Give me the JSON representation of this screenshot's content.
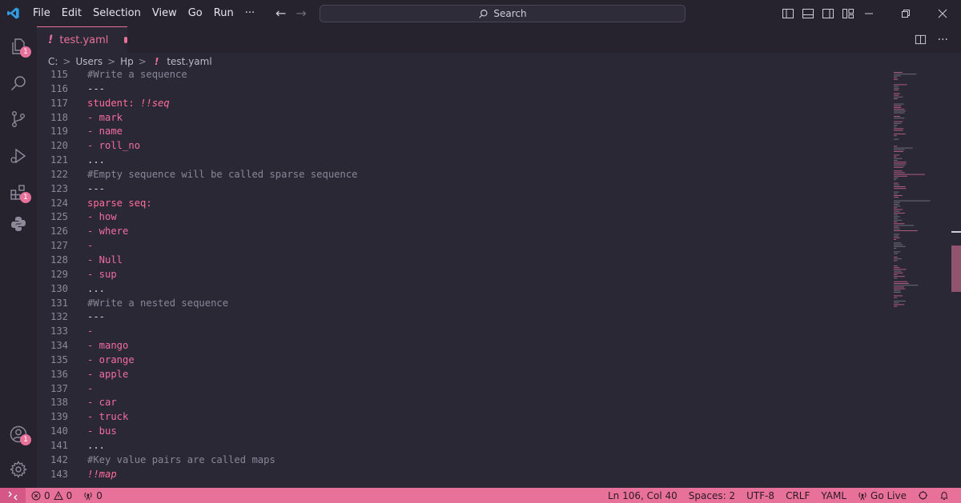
{
  "menu": [
    "File",
    "Edit",
    "Selection",
    "View",
    "Go",
    "Run",
    "···"
  ],
  "search": {
    "label": "Search"
  },
  "activity_badges": {
    "explorer": "1",
    "extensions": "1",
    "accounts": "1"
  },
  "tab": {
    "prefix": "!",
    "label": "test.yaml"
  },
  "breadcrumb": {
    "drive": "C:",
    "users": "Users",
    "user": "Hp",
    "file_prefix": "!",
    "file": "test.yaml"
  },
  "code_lines": [
    {
      "num": "115",
      "text": "#Write a sequence",
      "cls": "c-comment"
    },
    {
      "num": "116",
      "text": "---",
      "cls": "c-punct"
    },
    {
      "num": "117",
      "text": "student: ",
      "cls": "c-key",
      "tag": "!!seq"
    },
    {
      "num": "118",
      "text": "- mark",
      "cls": "c-item"
    },
    {
      "num": "119",
      "text": "- name",
      "cls": "c-item"
    },
    {
      "num": "120",
      "text": "- roll_no",
      "cls": "c-item"
    },
    {
      "num": "121",
      "text": "...",
      "cls": "c-punct"
    },
    {
      "num": "122",
      "text": "#Empty sequence will be called sparse sequence",
      "cls": "c-comment"
    },
    {
      "num": "123",
      "text": "---",
      "cls": "c-punct"
    },
    {
      "num": "124",
      "text": "sparse seq:",
      "cls": "c-key"
    },
    {
      "num": "125",
      "text": "- how",
      "cls": "c-item"
    },
    {
      "num": "126",
      "text": "- where",
      "cls": "c-item"
    },
    {
      "num": "127",
      "text": "-",
      "cls": "c-item"
    },
    {
      "num": "128",
      "text": "- Null",
      "cls": "c-item"
    },
    {
      "num": "129",
      "text": "- sup",
      "cls": "c-item"
    },
    {
      "num": "130",
      "text": "...",
      "cls": "c-punct"
    },
    {
      "num": "131",
      "text": "#Write a nested sequence",
      "cls": "c-comment"
    },
    {
      "num": "132",
      "text": "---",
      "cls": "c-punct"
    },
    {
      "num": "133",
      "text": "-",
      "cls": "c-item"
    },
    {
      "num": "134",
      "text": "- mango",
      "cls": "c-item"
    },
    {
      "num": "135",
      "text": "- orange",
      "cls": "c-item"
    },
    {
      "num": "136",
      "text": "- apple",
      "cls": "c-item"
    },
    {
      "num": "137",
      "text": "-",
      "cls": "c-item"
    },
    {
      "num": "138",
      "text": "- car",
      "cls": "c-item"
    },
    {
      "num": "139",
      "text": "- truck",
      "cls": "c-item"
    },
    {
      "num": "140",
      "text": "- bus",
      "cls": "c-item"
    },
    {
      "num": "141",
      "text": "...",
      "cls": "c-punct"
    },
    {
      "num": "142",
      "text": "#Key value pairs are called maps",
      "cls": "c-comment"
    },
    {
      "num": "143",
      "text": "",
      "cls": "c-tag",
      "tag": "!!map"
    }
  ],
  "status": {
    "errors": "0",
    "warnings": "0",
    "ports": "0",
    "cursor": "Ln 106, Col 40",
    "spaces": "Spaces: 2",
    "encoding": "UTF-8",
    "eol": "CRLF",
    "language": "YAML",
    "golive": "Go Live"
  },
  "colors": {
    "accent": "#e8719a",
    "background": "#2b2836",
    "chrome": "#26232f"
  }
}
